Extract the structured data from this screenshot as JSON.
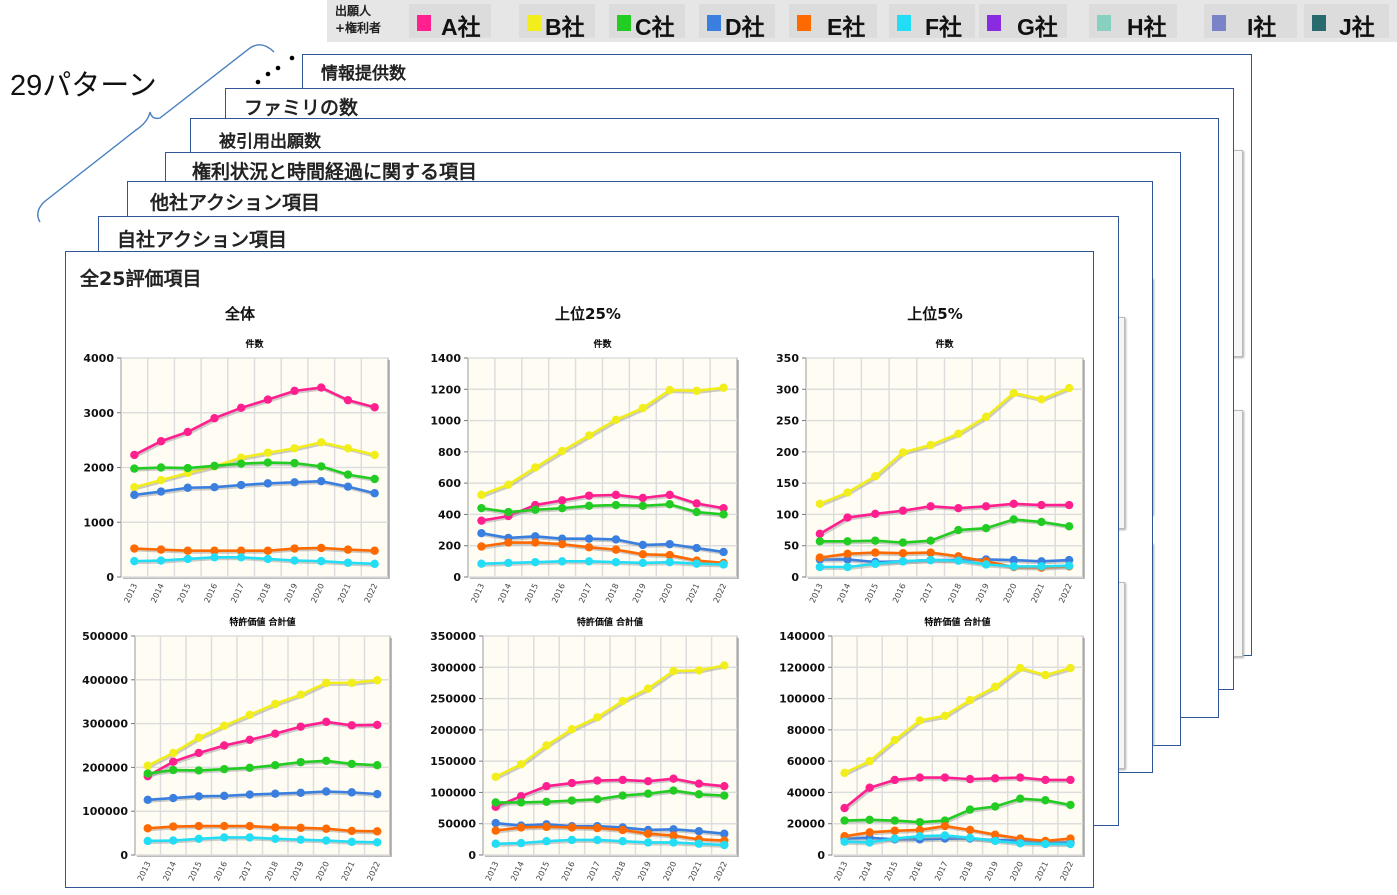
{
  "legend": {
    "header": [
      "出願人",
      "+権利者"
    ],
    "items": [
      {
        "label": "A社",
        "color": "#ff1f8f"
      },
      {
        "label": "B社",
        "color": "#f2ee1c"
      },
      {
        "label": "C社",
        "color": "#22cc22"
      },
      {
        "label": "D社",
        "color": "#3a7fe0"
      },
      {
        "label": "E社",
        "color": "#ff6a00"
      },
      {
        "label": "F社",
        "color": "#22ddf5"
      },
      {
        "label": "G社",
        "color": "#8a2be2"
      },
      {
        "label": "H社",
        "color": "#88d0c0"
      },
      {
        "label": "I社",
        "color": "#7b83c8"
      },
      {
        "label": "J社",
        "color": "#276b6e"
      }
    ]
  },
  "pattern_label": "29パターン",
  "panels": [
    "情報提供数",
    "ファミリの数",
    "被引用出願数",
    "権利状況と時間経過に関する項目",
    "他社アクション項目",
    "自社アクション項目",
    "全25評価項目"
  ],
  "column_titles": [
    "全体",
    "上位25%",
    "上位5%"
  ],
  "chart_data": [
    {
      "type": "line",
      "title": "件数",
      "column": "全体",
      "categories": [
        "2013",
        "2014",
        "2015",
        "2016",
        "2017",
        "2018",
        "2019",
        "2020",
        "2021",
        "2022"
      ],
      "ylim": [
        0,
        4000
      ],
      "yticks": [
        "0",
        "1000",
        "2000",
        "3000",
        "4000"
      ],
      "grid": true,
      "series": [
        {
          "name": "A社",
          "values": [
            2230,
            2480,
            2650,
            2900,
            3090,
            3240,
            3400,
            3460,
            3230,
            3100
          ]
        },
        {
          "name": "B社",
          "values": [
            1640,
            1770,
            1900,
            2020,
            2180,
            2270,
            2350,
            2460,
            2350,
            2230
          ]
        },
        {
          "name": "C社",
          "values": [
            1980,
            2000,
            1990,
            2030,
            2070,
            2090,
            2080,
            2020,
            1870,
            1790
          ]
        },
        {
          "name": "D社",
          "values": [
            1500,
            1560,
            1630,
            1640,
            1680,
            1710,
            1730,
            1750,
            1650,
            1530
          ]
        },
        {
          "name": "E社",
          "values": [
            520,
            500,
            480,
            480,
            480,
            480,
            520,
            530,
            500,
            480
          ]
        },
        {
          "name": "F社",
          "values": [
            290,
            300,
            330,
            360,
            360,
            330,
            300,
            290,
            260,
            240
          ]
        }
      ]
    },
    {
      "type": "line",
      "title": "件数",
      "column": "上位25%",
      "categories": [
        "2013",
        "2014",
        "2015",
        "2016",
        "2017",
        "2018",
        "2019",
        "2020",
        "2021",
        "2022"
      ],
      "ylim": [
        0,
        1400
      ],
      "yticks": [
        "0",
        "200",
        "400",
        "600",
        "800",
        "1000",
        "1200",
        "1400"
      ],
      "grid": true,
      "series": [
        {
          "name": "A社",
          "values": [
            360,
            390,
            460,
            490,
            520,
            525,
            505,
            525,
            470,
            440
          ]
        },
        {
          "name": "B社",
          "values": [
            525,
            590,
            700,
            805,
            905,
            1005,
            1080,
            1195,
            1190,
            1210
          ]
        },
        {
          "name": "C社",
          "values": [
            440,
            415,
            430,
            440,
            455,
            460,
            455,
            465,
            415,
            400
          ]
        },
        {
          "name": "D社",
          "values": [
            280,
            250,
            260,
            245,
            245,
            240,
            205,
            210,
            185,
            160
          ]
        },
        {
          "name": "E社",
          "values": [
            195,
            220,
            220,
            210,
            190,
            175,
            145,
            140,
            105,
            90
          ]
        },
        {
          "name": "F社",
          "values": [
            85,
            90,
            95,
            100,
            100,
            95,
            90,
            95,
            85,
            80
          ]
        }
      ]
    },
    {
      "type": "line",
      "title": "件数",
      "column": "上位5%",
      "categories": [
        "2013",
        "2014",
        "2015",
        "2016",
        "2017",
        "2018",
        "2019",
        "2020",
        "2021",
        "2022"
      ],
      "ylim": [
        0,
        350
      ],
      "yticks": [
        "0",
        "50",
        "100",
        "150",
        "200",
        "250",
        "300",
        "350"
      ],
      "grid": true,
      "series": [
        {
          "name": "A社",
          "values": [
            69,
            95,
            101,
            106,
            113,
            110,
            113,
            117,
            115,
            115
          ]
        },
        {
          "name": "B社",
          "values": [
            117,
            135,
            161,
            199,
            211,
            229,
            256,
            294,
            284,
            302
          ]
        },
        {
          "name": "C社",
          "values": [
            57,
            57,
            58,
            55,
            58,
            75,
            78,
            92,
            88,
            81
          ]
        },
        {
          "name": "D社",
          "values": [
            28,
            28,
            24,
            25,
            27,
            27,
            28,
            27,
            25,
            27
          ]
        },
        {
          "name": "E社",
          "values": [
            31,
            37,
            39,
            38,
            39,
            33,
            25,
            16,
            15,
            17
          ]
        },
        {
          "name": "F社",
          "values": [
            16,
            16,
            21,
            25,
            27,
            26,
            20,
            17,
            17,
            18
          ]
        }
      ]
    },
    {
      "type": "line",
      "title": "特許価値 合計値",
      "column": "全体",
      "categories": [
        "2013",
        "2014",
        "2015",
        "2016",
        "2017",
        "2018",
        "2019",
        "2020",
        "2021",
        "2022"
      ],
      "ylim": [
        0,
        500000
      ],
      "yticks": [
        "0",
        "100000",
        "200000",
        "300000",
        "400000",
        "500000"
      ],
      "grid": true,
      "series": [
        {
          "name": "A社",
          "values": [
            180000,
            213000,
            233000,
            250000,
            263000,
            277000,
            293000,
            304000,
            296000,
            297000
          ]
        },
        {
          "name": "B社",
          "values": [
            204000,
            233000,
            268000,
            295000,
            320000,
            345000,
            366000,
            393000,
            393000,
            399000
          ]
        },
        {
          "name": "C社",
          "values": [
            186000,
            194000,
            193000,
            196000,
            199000,
            205000,
            212000,
            215000,
            208000,
            205000
          ]
        },
        {
          "name": "D社",
          "values": [
            126000,
            130000,
            134000,
            135000,
            138000,
            140000,
            142000,
            145000,
            143000,
            139000
          ]
        },
        {
          "name": "E社",
          "values": [
            61000,
            65000,
            66000,
            66000,
            66000,
            63000,
            62000,
            60000,
            55000,
            54000
          ]
        },
        {
          "name": "F社",
          "values": [
            32000,
            33000,
            37000,
            40000,
            40000,
            37000,
            35000,
            33000,
            30000,
            29000
          ]
        }
      ]
    },
    {
      "type": "line",
      "title": "特許価値 合計値",
      "column": "上位25%",
      "categories": [
        "2013",
        "2014",
        "2015",
        "2016",
        "2017",
        "2018",
        "2019",
        "2020",
        "2021",
        "2022"
      ],
      "ylim": [
        0,
        350000
      ],
      "yticks": [
        "0",
        "50000",
        "100000",
        "150000",
        "200000",
        "250000",
        "300000",
        "350000"
      ],
      "grid": true,
      "series": [
        {
          "name": "A社",
          "values": [
            77000,
            94000,
            110000,
            115000,
            119000,
            120000,
            118000,
            122000,
            114000,
            110000
          ]
        },
        {
          "name": "B社",
          "values": [
            125000,
            145000,
            175000,
            201000,
            220000,
            246000,
            266000,
            294000,
            295000,
            303000
          ]
        },
        {
          "name": "C社",
          "values": [
            84000,
            84000,
            85000,
            87000,
            89000,
            95000,
            98000,
            103000,
            97000,
            95000
          ]
        },
        {
          "name": "D社",
          "values": [
            51000,
            47000,
            49000,
            46000,
            46000,
            44000,
            40000,
            41000,
            38000,
            34000
          ]
        },
        {
          "name": "E社",
          "values": [
            39000,
            44000,
            45000,
            44000,
            43000,
            40000,
            34000,
            31000,
            25000,
            23000
          ]
        },
        {
          "name": "F社",
          "values": [
            18000,
            19000,
            22000,
            24000,
            24000,
            22000,
            20000,
            20000,
            18000,
            16000
          ]
        }
      ]
    },
    {
      "type": "line",
      "title": "特許価値 合計値",
      "column": "上位5%",
      "categories": [
        "2013",
        "2014",
        "2015",
        "2016",
        "2017",
        "2018",
        "2019",
        "2020",
        "2021",
        "2022"
      ],
      "ylim": [
        0,
        140000
      ],
      "yticks": [
        "0",
        "20000",
        "40000",
        "60000",
        "80000",
        "100000",
        "120000",
        "140000"
      ],
      "grid": true,
      "series": [
        {
          "name": "A社",
          "values": [
            30000,
            43000,
            48000,
            49500,
            49500,
            48500,
            49000,
            49500,
            48000,
            48000
          ]
        },
        {
          "name": "B社",
          "values": [
            52500,
            60000,
            73500,
            86000,
            89000,
            99000,
            107500,
            119500,
            115000,
            119500
          ]
        },
        {
          "name": "C社",
          "values": [
            22000,
            22500,
            22000,
            21000,
            22000,
            29000,
            31000,
            36000,
            35000,
            32000
          ]
        },
        {
          "name": "D社",
          "values": [
            10500,
            11000,
            10000,
            10000,
            10500,
            10500,
            9500,
            9500,
            8000,
            8000
          ]
        },
        {
          "name": "E社",
          "values": [
            12000,
            14500,
            15500,
            16000,
            18500,
            16000,
            13000,
            10500,
            9000,
            10500
          ]
        },
        {
          "name": "F社",
          "values": [
            8500,
            8000,
            10500,
            12000,
            12500,
            11000,
            9000,
            7500,
            7000,
            7000
          ]
        }
      ]
    }
  ]
}
